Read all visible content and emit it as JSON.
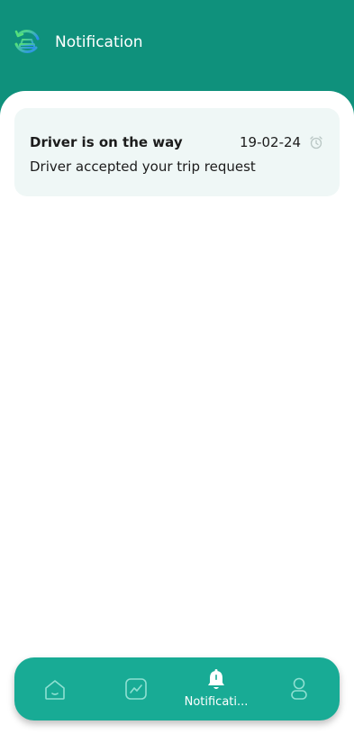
{
  "header": {
    "title": "Notification",
    "logo_icon": "car-swap-icon",
    "background_color": "#0f917c"
  },
  "notifications": [
    {
      "title": "Driver is on the way",
      "date": "19-02-24",
      "time_icon": "alarm-clock-icon",
      "body": "Driver accepted your trip request"
    }
  ],
  "bottom_nav": {
    "background_color": "#18ab95",
    "items": [
      {
        "icon": "home-icon",
        "label": "",
        "active": false
      },
      {
        "icon": "chart-icon",
        "label": "",
        "active": false
      },
      {
        "icon": "bell-icon",
        "label": "Notificati...",
        "active": true
      },
      {
        "icon": "profile-icon",
        "label": "",
        "active": false
      }
    ]
  }
}
